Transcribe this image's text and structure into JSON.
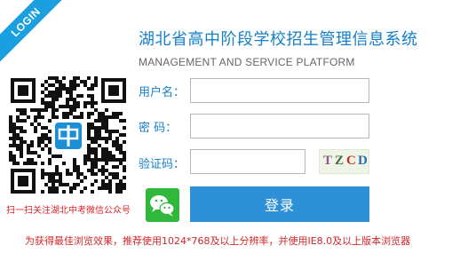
{
  "ribbon": {
    "label": "LOGIN"
  },
  "header": {
    "title": "湖北省高中阶段学校招生管理信息系统",
    "subtitle": "MANAGEMENT AND SERVICE PLATFORM"
  },
  "qr": {
    "caption": "扫一扫关注湖北中考微信公众号",
    "logo_icon": "zhong-logo-icon"
  },
  "form": {
    "username_label": "用户名：",
    "username_value": "",
    "password_label": "密    码：",
    "password_value": "",
    "captcha_label": "验证码：",
    "captcha_value": "",
    "captcha_chars": [
      "T",
      "Z",
      "C",
      "D"
    ],
    "captcha_colors": [
      "#8b5a8b",
      "#4a6a4a",
      "#c03030",
      "#2e6cab"
    ],
    "login_label": "登录"
  },
  "wechat": {
    "icon": "wechat-icon",
    "color": "#2fb83b"
  },
  "notice": "为获得最佳浏览效果，推荐使用1024*768及以上分辨率，并使用IE8.0及以上版本浏览器",
  "colors": {
    "accent": "#1480c8",
    "button": "#2e90d7",
    "warning": "#d2262a"
  }
}
